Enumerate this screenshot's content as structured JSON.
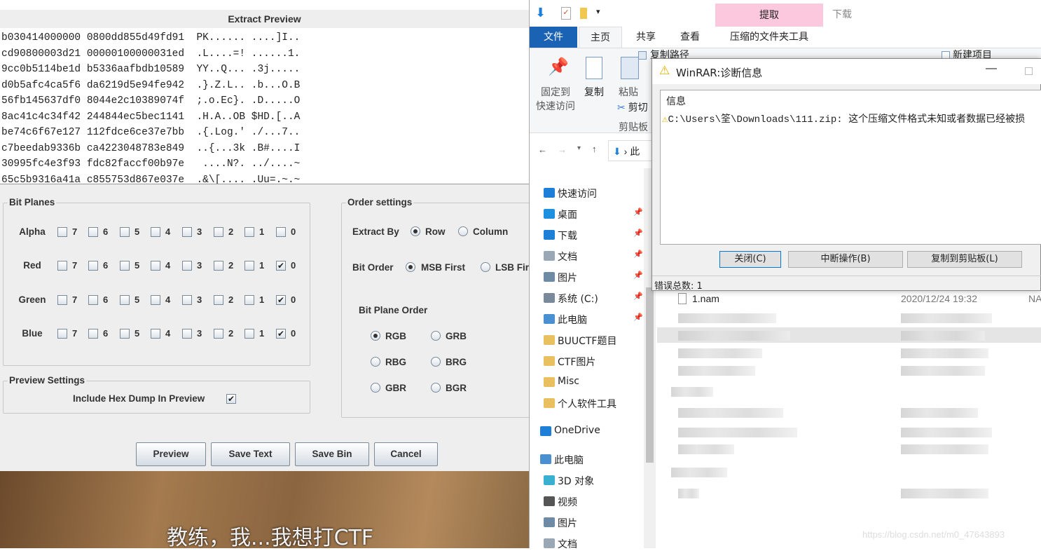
{
  "stegsolve": {
    "title": "Extract Preview",
    "hex_lines": [
      "b030414000000 0800dd855d49fd91  PK...... ....]I..",
      "cd90800003d21 00000100000031ed  .L....=! ......1.",
      "9cc0b5114be1d b5336aafbdb10589  YY..Q... .3j.....",
      "d0b5afc4ca5f6 da6219d5e94fe942  .}.Z.L.. .b...O.B",
      "56fb145637df0 8044e2c10389074f  ;.o.Ec}. .D.....O",
      "8ac41c4c34f42 244844ec5bec1141  .H.A..OB $HD.[..A",
      "be74c6f67e127 112fdce6ce37e7bb  .{.Log.' ./...7..",
      "c7beedab9336b ca4223048783e849  ..{...3k .B#....I",
      "30995fc4e3f93 fdc82faccf00b97e   ....N?. ../....~",
      "65c5b9316a41a c855753d867e037e  .&\\[.... .Uu=.~.~"
    ],
    "bit_planes": {
      "label": "Bit Planes",
      "bits": [
        "7",
        "6",
        "5",
        "4",
        "3",
        "2",
        "1",
        "0"
      ],
      "rows": [
        {
          "name": "Alpha",
          "checked": []
        },
        {
          "name": "Red",
          "checked": [
            "0"
          ]
        },
        {
          "name": "Green",
          "checked": [
            "0"
          ]
        },
        {
          "name": "Blue",
          "checked": [
            "0"
          ]
        }
      ]
    },
    "order": {
      "label": "Order settings",
      "extract_by_label": "Extract By",
      "extract_by_options": [
        "Row",
        "Column"
      ],
      "extract_by_selected": "Row",
      "bit_order_label": "Bit Order",
      "bit_order_options": [
        "MSB First",
        "LSB First"
      ],
      "bit_order_selected": "MSB First",
      "plane_order_label": "Bit Plane Order",
      "plane_order_options": [
        "RGB",
        "GRB",
        "RBG",
        "BRG",
        "GBR",
        "BGR"
      ],
      "plane_order_selected": "RGB"
    },
    "preview_settings": {
      "label": "Preview Settings",
      "hex_dump_label": "Include Hex Dump In Preview",
      "hex_dump_checked": true
    },
    "buttons": {
      "preview": "Preview",
      "save_text": "Save Text",
      "save_bin": "Save Bin",
      "cancel": "Cancel"
    }
  },
  "video": {
    "subtitle": "教练，我...我想打CTF",
    "watermark": "https://blog.csdn.net/m0_47643893"
  },
  "explorer": {
    "context_tab": "提取",
    "download_title": "下载",
    "tabs": [
      "文件",
      "主页",
      "共享",
      "查看",
      "压缩的文件夹工具"
    ],
    "ribbon": {
      "pin": "固定到\n快速访问",
      "copy": "复制",
      "paste": "粘贴",
      "cut": "剪切",
      "copy_path": "复制路径",
      "new_item": "新建项目",
      "group_clipboard": "剪贴板"
    },
    "address": "此",
    "nav": [
      {
        "label": "快速访问",
        "pinned": false,
        "color": "#1e7fd8"
      },
      {
        "label": "桌面",
        "pinned": true,
        "color": "#1e90e0"
      },
      {
        "label": "下载",
        "pinned": true,
        "color": "#1e7fd8"
      },
      {
        "label": "文档",
        "pinned": true,
        "color": "#9aa7b5"
      },
      {
        "label": "图片",
        "pinned": true,
        "color": "#6f8aa5"
      },
      {
        "label": "系统 (C:)",
        "pinned": true,
        "color": "#7a8a9a"
      },
      {
        "label": "此电脑",
        "pinned": true,
        "color": "#4a90d0"
      },
      {
        "label": "BUUCTF题目",
        "pinned": false,
        "color": "#e8c060"
      },
      {
        "label": "CTF图片",
        "pinned": false,
        "color": "#e8c060"
      },
      {
        "label": "Misc",
        "pinned": false,
        "color": "#e8c060"
      },
      {
        "label": "个人软件工具",
        "pinned": false,
        "color": "#e8c060"
      },
      {
        "label": "OneDrive",
        "pinned": false,
        "color": "#1e7fd8"
      },
      {
        "label": "此电脑",
        "pinned": false,
        "color": "#4a90d0"
      },
      {
        "label": "3D 对象",
        "pinned": false,
        "color": "#3ab0d0"
      },
      {
        "label": "视频",
        "pinned": false,
        "color": "#555"
      },
      {
        "label": "图片",
        "pinned": false,
        "color": "#6f8aa5"
      },
      {
        "label": "文档",
        "pinned": false,
        "color": "#9aa7b5"
      }
    ],
    "file": {
      "name": "1.nam",
      "date": "2020/12/24 19:32",
      "type": "NA"
    }
  },
  "winrar": {
    "title": "WinRAR:诊断信息",
    "header": "信息",
    "message": "C:\\Users\\筌\\Downloads\\111.zip: 这个压缩文件格式未知或者数据已经被损",
    "buttons": {
      "close": "关闭(C)",
      "abort": "中断操作(B)",
      "copy": "复制到剪贴板(L)"
    },
    "error_count": "错误总数: 1"
  }
}
